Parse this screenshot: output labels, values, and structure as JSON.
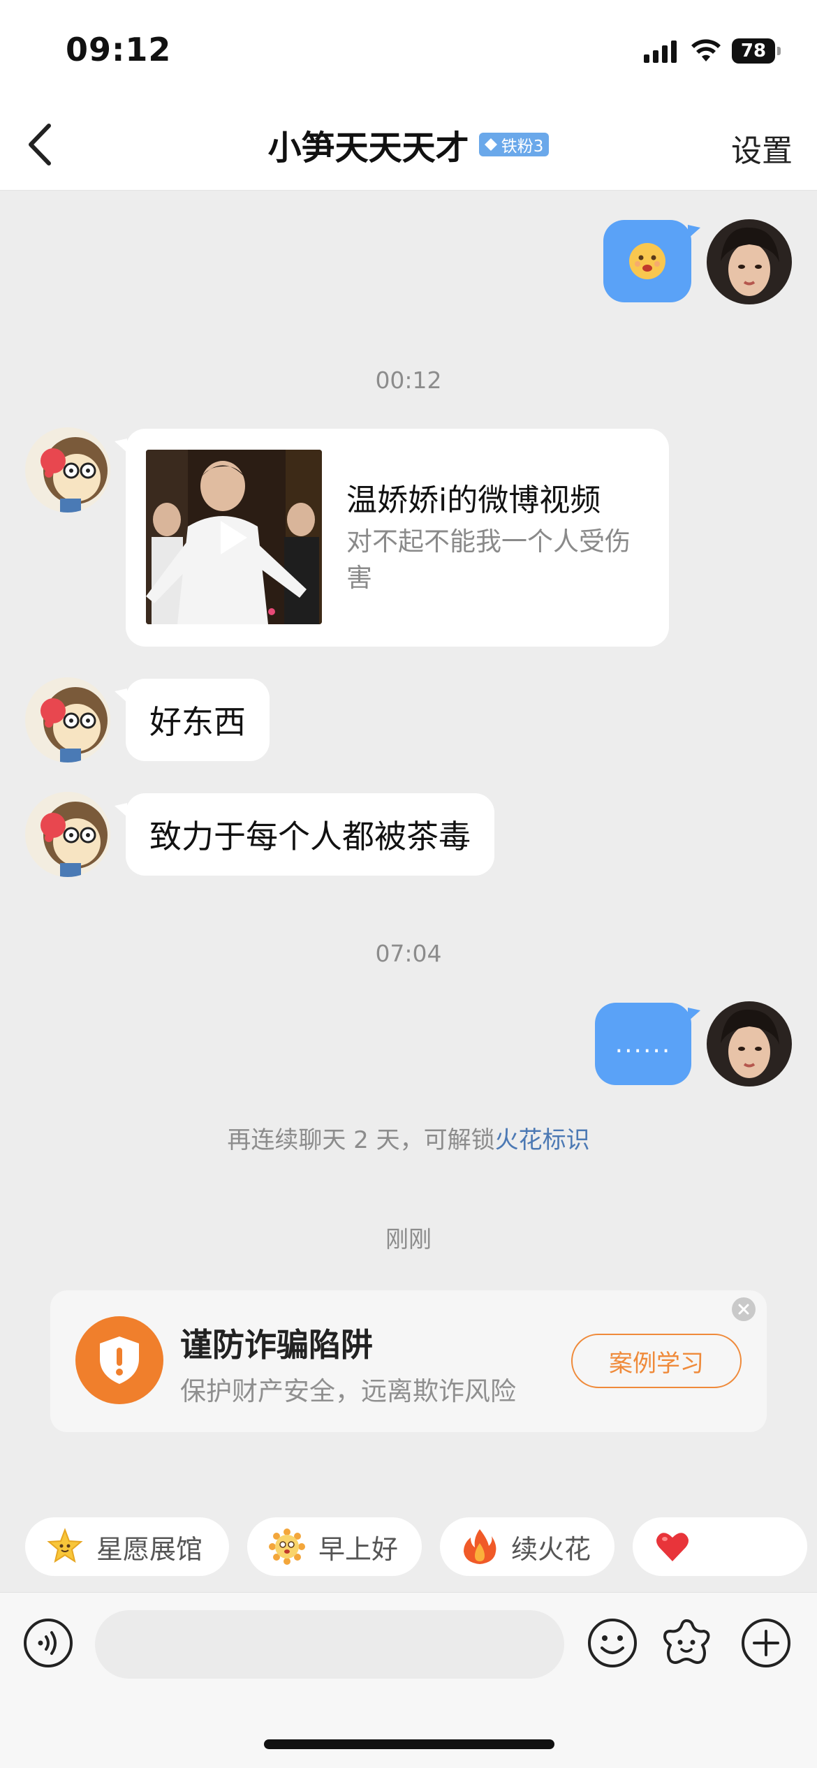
{
  "status_bar": {
    "time": "09:12",
    "battery": "78"
  },
  "nav": {
    "title": "小笋天天天才",
    "fan_badge": "铁粉3",
    "settings": "设置"
  },
  "messages": {
    "ts1": "00:12",
    "video_card": {
      "title": "温娇娇i的微博视频",
      "desc": "对不起不能我一个人受伤害"
    },
    "msg2": "好东西",
    "msg3": "致力于每个人都被茶毒",
    "ts2": "07:04",
    "out2": "......",
    "system_text": "再连续聊天 2 天，可解锁",
    "system_link": "火花标识",
    "ts3": "刚刚"
  },
  "warning": {
    "title": "谨防诈骗陷阱",
    "subtitle": "保护财产安全，远离欺诈风险",
    "button": "案例学习"
  },
  "quick_replies": [
    {
      "label": "星愿展馆",
      "icon": "star-face-icon"
    },
    {
      "label": "早上好",
      "icon": "sun-face-icon"
    },
    {
      "label": "续火花",
      "icon": "flame-icon"
    },
    {
      "label": "",
      "icon": "heart-icon"
    }
  ],
  "input": {
    "placeholder": ""
  },
  "colors": {
    "accent_blue": "#5aa2f7",
    "warning_orange": "#f07f2c",
    "link_blue": "#4c79b4"
  }
}
